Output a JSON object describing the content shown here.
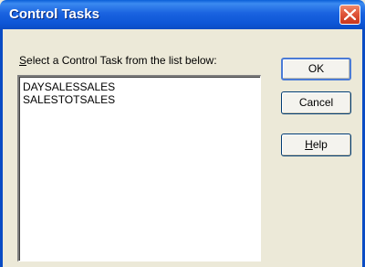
{
  "window": {
    "title": "Control Tasks"
  },
  "prompt": {
    "text_accel": "S",
    "text_rest": "elect a Control Task from the list below:"
  },
  "list": {
    "items": [
      "DAYSALESSALES",
      "SALESTOTSALES"
    ]
  },
  "buttons": {
    "ok": "OK",
    "cancel": "Cancel",
    "help_accel": "H",
    "help_rest": "elp"
  },
  "icons": {
    "close": "close-icon"
  },
  "colors": {
    "titlebar": "#0d56d6",
    "close": "#e0553a",
    "dialog_bg": "#ece9d8"
  }
}
